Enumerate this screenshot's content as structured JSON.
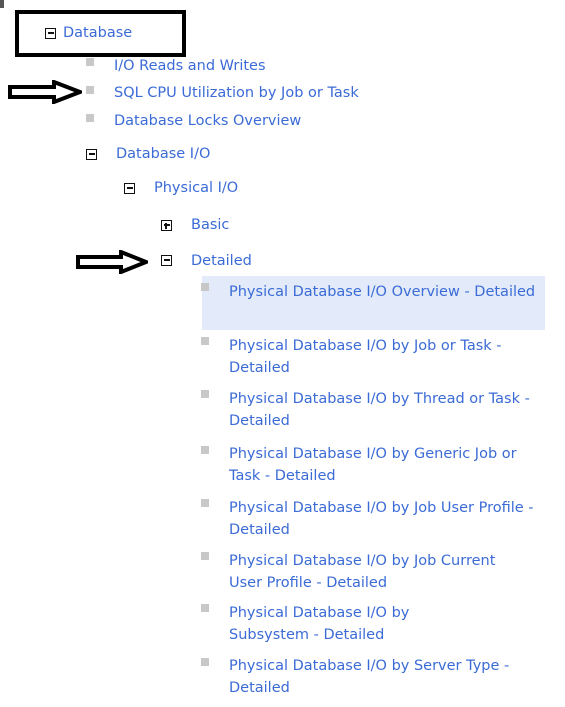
{
  "tree": {
    "database": {
      "label": "Database",
      "state": "expanded"
    },
    "database_children": [
      {
        "label": "I/O Reads and Writes"
      },
      {
        "label": "SQL CPU Utilization by Job or Task"
      },
      {
        "label": "Database Locks Overview"
      }
    ],
    "database_io": {
      "label": "Database I/O",
      "state": "expanded"
    },
    "physical_io": {
      "label": "Physical I/O",
      "state": "expanded"
    },
    "basic": {
      "label": "Basic",
      "state": "collapsed"
    },
    "detailed": {
      "label": "Detailed",
      "state": "expanded"
    },
    "detailed_items": [
      {
        "label": "Physical Database I/O Overview - Detailed",
        "selected": true
      },
      {
        "label": "Physical Database I/O by Job or Task - Detailed"
      },
      {
        "label": "Physical Database I/O by Thread or Task - Detailed"
      },
      {
        "label": "Physical Database I/O by Generic Job or Task - Detailed"
      },
      {
        "label": "Physical Database I/O by Job User Profile - Detailed"
      },
      {
        "label": "Physical Database I/O by Job Current User Profile - Detailed"
      },
      {
        "label": "Physical Database I/O by Subsystem - Detailed"
      },
      {
        "label": "Physical Database I/O by Server Type - Detailed"
      }
    ]
  },
  "icons": {
    "expanded": "minus-box-icon",
    "collapsed": "plus-box-icon",
    "leaf": "gray-square-bullet-icon",
    "annotation_arrow": "right-arrow-icon",
    "annotation_box": "rectangle-outline"
  },
  "colors": {
    "link": "#3b6bd6",
    "selected_bg": "#e3ebfa",
    "bullet": "#c8c8c8",
    "annotation": "#000000"
  }
}
